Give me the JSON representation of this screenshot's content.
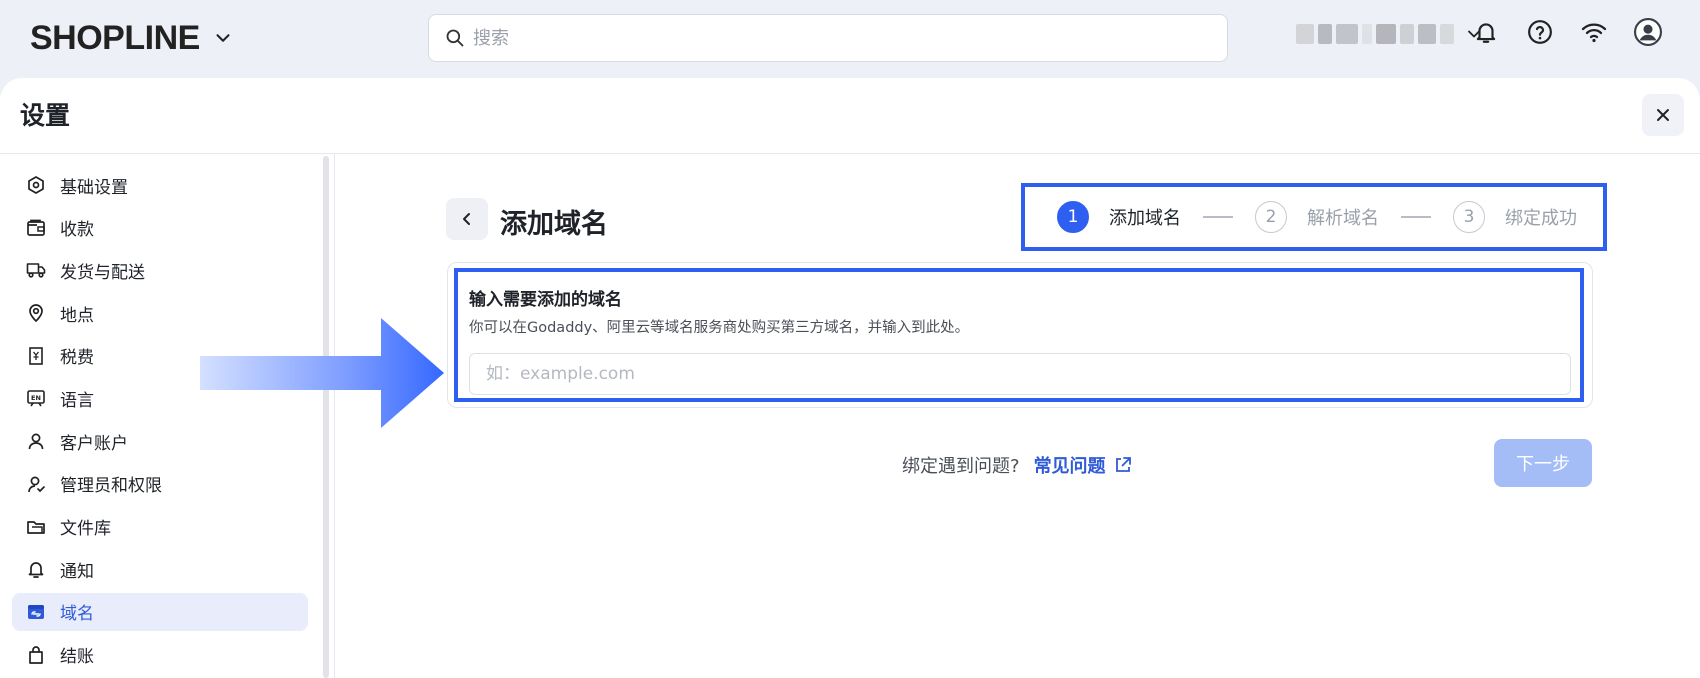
{
  "topbar": {
    "logo": "SHOPLINE",
    "search_placeholder": "搜索"
  },
  "panel": {
    "title": "设置",
    "close_label": "×"
  },
  "sidebar": {
    "items": [
      {
        "label": "基础设置",
        "icon": "settings-hex-icon"
      },
      {
        "label": "收款",
        "icon": "wallet-icon"
      },
      {
        "label": "发货与配送",
        "icon": "truck-icon"
      },
      {
        "label": "地点",
        "icon": "location-pin-icon"
      },
      {
        "label": "税费",
        "icon": "receipt-icon"
      },
      {
        "label": "语言",
        "icon": "language-icon"
      },
      {
        "label": "客户账户",
        "icon": "user-icon"
      },
      {
        "label": "管理员和权限",
        "icon": "admin-user-icon"
      },
      {
        "label": "文件库",
        "icon": "folder-icon"
      },
      {
        "label": "通知",
        "icon": "bell-icon"
      },
      {
        "label": "域名",
        "icon": "domain-icon",
        "active": true
      },
      {
        "label": "结账",
        "icon": "bag-icon"
      }
    ]
  },
  "content": {
    "heading": "添加域名",
    "steps": [
      {
        "num": "1",
        "label": "添加域名",
        "active": true
      },
      {
        "num": "2",
        "label": "解析域名",
        "active": false
      },
      {
        "num": "3",
        "label": "绑定成功",
        "active": false
      }
    ],
    "card": {
      "title": "输入需要添加的域名",
      "description": "你可以在Godaddy、阿里云等域名服务商处购买第三方域名，并输入到此处。",
      "input_placeholder": "如：example.com",
      "input_value": ""
    },
    "help_text": "绑定遇到问题?",
    "help_link": "常见问题",
    "next_button": "下一步"
  },
  "colors": {
    "accent": "#2f5ff0",
    "active_bg": "#e8ecfb",
    "next_disabled": "#a4bdf6"
  }
}
